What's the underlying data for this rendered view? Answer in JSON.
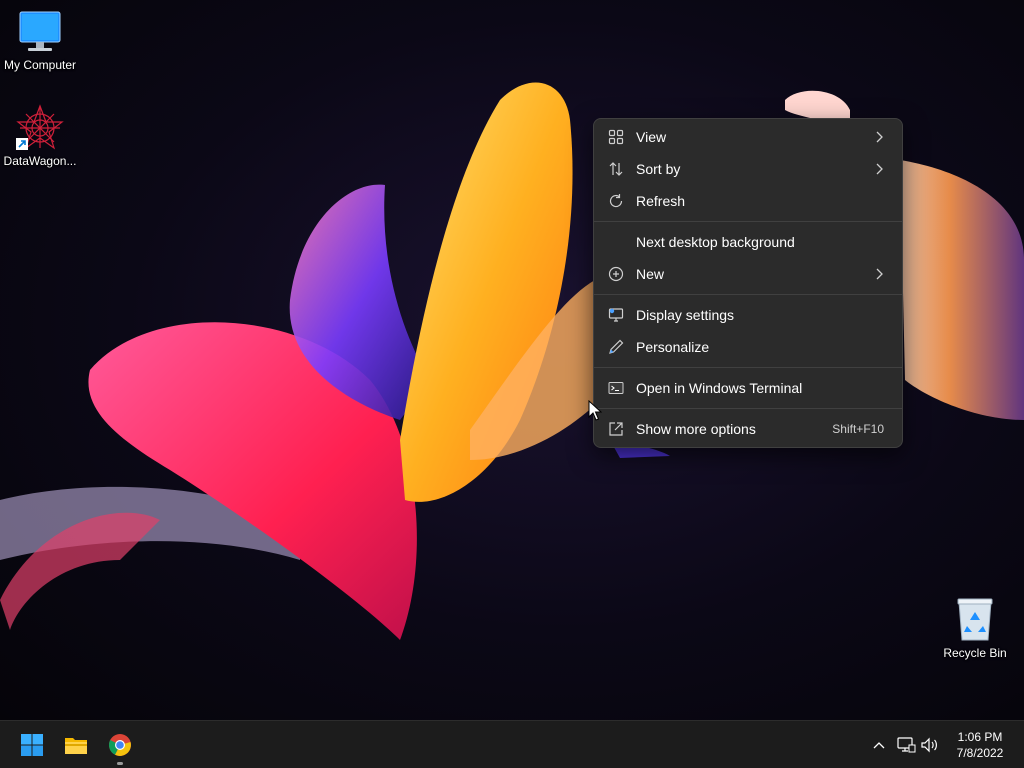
{
  "desktop_icons": [
    {
      "label": "My Computer",
      "icon": "monitor-icon"
    },
    {
      "label": "DataWagon...",
      "icon": "datawagon-icon"
    },
    {
      "label": "Recycle Bin",
      "icon": "recycle-bin-icon"
    }
  ],
  "context_menu": {
    "items": [
      {
        "label": "View",
        "icon": "grid-icon",
        "submenu": true
      },
      {
        "label": "Sort by",
        "icon": "sort-icon",
        "submenu": true
      },
      {
        "label": "Refresh",
        "icon": "refresh-icon"
      },
      {
        "label": "Next desktop background"
      },
      {
        "label": "New",
        "icon": "plus-circle-icon",
        "submenu": true
      },
      {
        "label": "Display settings",
        "icon": "display-icon"
      },
      {
        "label": "Personalize",
        "icon": "pen-icon"
      },
      {
        "label": "Open in Windows Terminal",
        "icon": "terminal-icon"
      },
      {
        "label": "Show more options",
        "icon": "external-icon",
        "shortcut": "Shift+F10"
      }
    ]
  },
  "taskbar": {
    "apps": [
      "windows-start-icon",
      "file-explorer-icon",
      "chrome-icon"
    ],
    "tray_icons": [
      "chevron-up-icon",
      "network-icon",
      "volume-icon"
    ],
    "clock": {
      "time": "1:06 PM",
      "date": "7/8/2022"
    }
  },
  "colors": {
    "accent": "#0078d4",
    "menu_bg": "#2b2b2b",
    "taskbar_bg": "#1c1c1c"
  }
}
